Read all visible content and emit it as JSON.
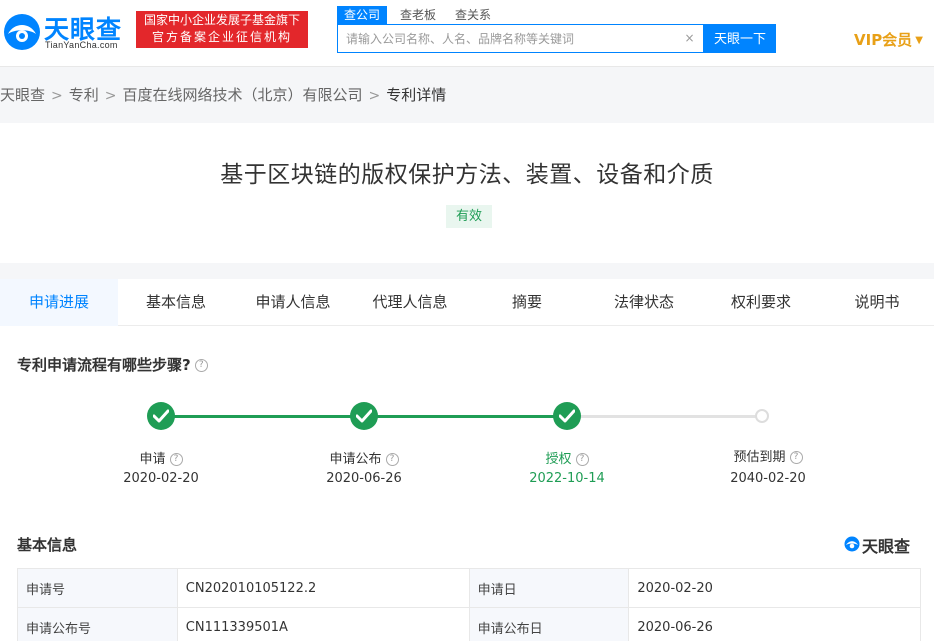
{
  "header": {
    "logo_text": "天眼查",
    "logo_sub": "TianYanCha.com",
    "badge_line1": "国家中小企业发展子基金旗下",
    "badge_line2": "官方备案企业征信机构",
    "search_tabs": [
      "查公司",
      "查老板",
      "查关系"
    ],
    "search_placeholder": "请输入公司名称、人名、品牌名称等关键词",
    "search_button": "天眼一下",
    "vip_label": "VIP会员"
  },
  "breadcrumb": [
    "天眼查",
    "专利",
    "百度在线网络技术（北京）有限公司",
    "专利详情"
  ],
  "patent": {
    "title": "基于区块链的版权保护方法、装置、设备和介质",
    "status": "有效"
  },
  "tabs": [
    "申请进展",
    "基本信息",
    "申请人信息",
    "代理人信息",
    "摘要",
    "法律状态",
    "权利要求",
    "说明书"
  ],
  "progress": {
    "section_title": "专利申请流程有哪些步骤?",
    "steps": [
      {
        "label": "申请",
        "date": "2020-02-20",
        "state": "done"
      },
      {
        "label": "申请公布",
        "date": "2020-06-26",
        "state": "done"
      },
      {
        "label": "授权",
        "date": "2022-10-14",
        "state": "current"
      },
      {
        "label": "预估到期",
        "date": "2040-02-20",
        "state": "pending"
      }
    ]
  },
  "basic_info": {
    "section_title": "基本信息",
    "brand": "天眼查",
    "rows": [
      {
        "k1": "申请号",
        "v1": "CN202010105122.2",
        "k2": "申请日",
        "v2": "2020-02-20"
      },
      {
        "k1": "申请公布号",
        "v1": "CN111339501A",
        "k2": "申请公布日",
        "v2": "2020-06-26"
      }
    ]
  },
  "colors": {
    "brand_blue": "#0084ff",
    "success_green": "#1f9d55",
    "badge_red": "#e3272b",
    "vip_gold": "#e8a017"
  }
}
